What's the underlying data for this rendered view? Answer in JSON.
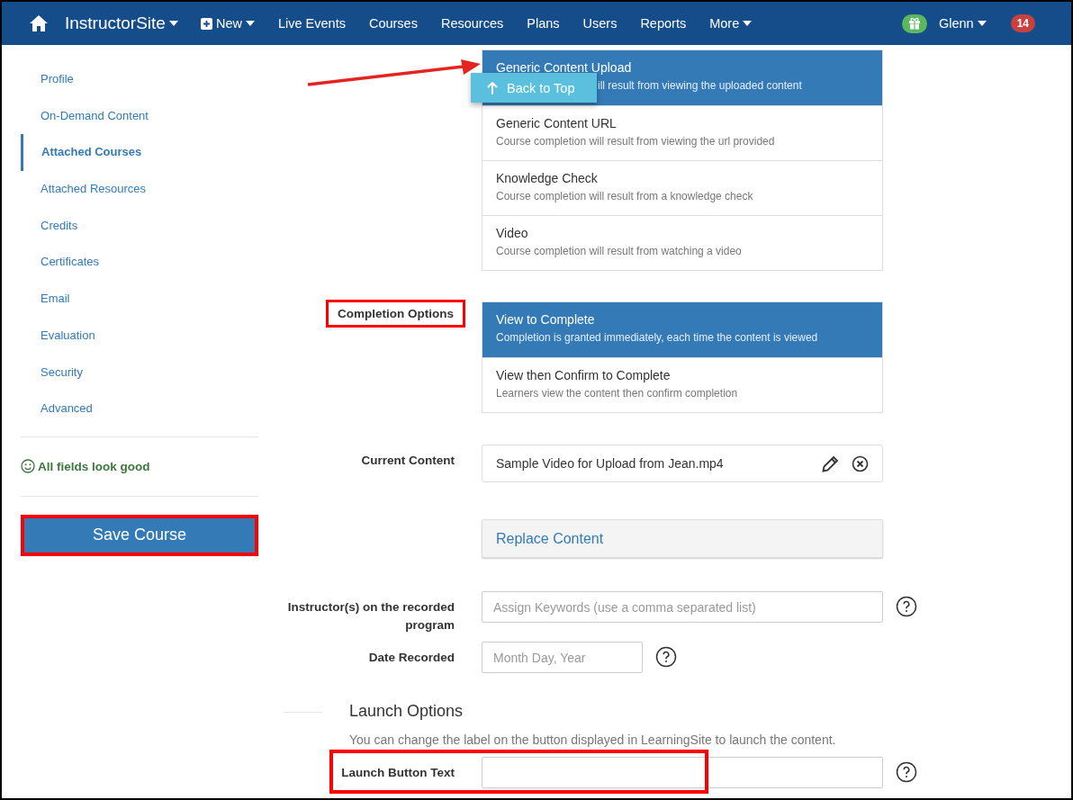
{
  "nav": {
    "brand": "InstructorSite",
    "items": [
      {
        "label": "New",
        "kind": "new"
      },
      {
        "label": "Live Events",
        "kind": "link"
      },
      {
        "label": "Courses",
        "kind": "link"
      },
      {
        "label": "Resources",
        "kind": "link"
      },
      {
        "label": "Plans",
        "kind": "link"
      },
      {
        "label": "Users",
        "kind": "link"
      },
      {
        "label": "Reports",
        "kind": "link"
      },
      {
        "label": "More",
        "kind": "dropdown"
      }
    ],
    "user": "Glenn",
    "badge": "14"
  },
  "sidebar": {
    "items": [
      {
        "label": "Profile",
        "selected": false
      },
      {
        "label": "On-Demand Content",
        "selected": false
      },
      {
        "label": "Attached Courses",
        "selected": true
      },
      {
        "label": "Attached Resources",
        "selected": false
      },
      {
        "label": "Credits",
        "selected": false
      },
      {
        "label": "Certificates",
        "selected": false
      },
      {
        "label": "Email",
        "selected": false
      },
      {
        "label": "Evaluation",
        "selected": false
      },
      {
        "label": "Security",
        "selected": false
      },
      {
        "label": "Advanced",
        "selected": false
      }
    ],
    "status": "All fields look good",
    "save_button": {
      "label": "Save Course",
      "highlighted": true
    }
  },
  "content_types": [
    {
      "title": "Generic Content Upload",
      "description": "ill result from viewing the uploaded content",
      "selected": true
    },
    {
      "title": "Generic Content URL",
      "description": "Course completion will result from viewing the url provided",
      "selected": false
    },
    {
      "title": "Knowledge Check",
      "description": "Course completion will result from a knowledge check",
      "selected": false
    },
    {
      "title": "Video",
      "description": "Course completion will result from watching a video",
      "selected": false
    }
  ],
  "back_to_top": "Back to Top",
  "completion": {
    "label": "Completion Options",
    "highlighted": true,
    "options": [
      {
        "title": "View to Complete",
        "description": "Completion is granted immediately, each time the content is viewed",
        "selected": true
      },
      {
        "title": "View then Confirm to Complete",
        "description": "Learners view the content then confirm completion",
        "selected": false
      }
    ]
  },
  "current_content": {
    "label": "Current Content",
    "value": "Sample Video for Upload from Jean.mp4"
  },
  "replace_button": "Replace Content",
  "instructors": {
    "label": "Instructor(s) on the recorded program",
    "placeholder": "Assign Keywords (use a comma separated list)"
  },
  "date_recorded": {
    "label": "Date Recorded",
    "placeholder": "Month Day, Year"
  },
  "launch": {
    "heading": "Launch Options",
    "description": "You can change the label on the button displayed in LearningSite to launch the content.",
    "field_label": "Launch Button Text",
    "highlighted": true
  }
}
